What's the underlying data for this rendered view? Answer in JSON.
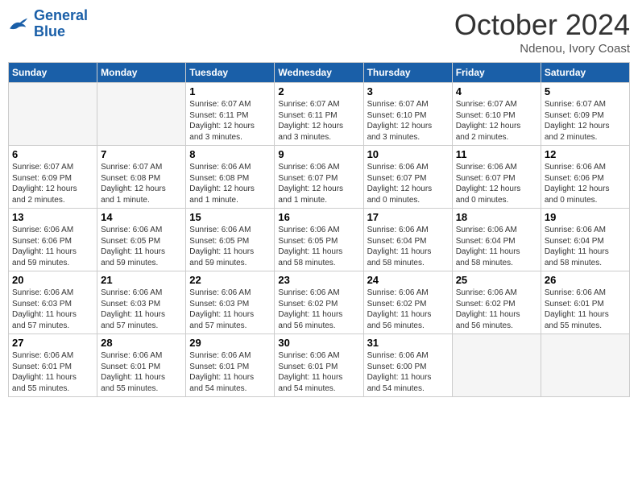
{
  "header": {
    "logo_line1": "General",
    "logo_line2": "Blue",
    "month": "October 2024",
    "location": "Ndenou, Ivory Coast"
  },
  "weekdays": [
    "Sunday",
    "Monday",
    "Tuesday",
    "Wednesday",
    "Thursday",
    "Friday",
    "Saturday"
  ],
  "weeks": [
    [
      {
        "day": "",
        "info": ""
      },
      {
        "day": "",
        "info": ""
      },
      {
        "day": "1",
        "info": "Sunrise: 6:07 AM\nSunset: 6:11 PM\nDaylight: 12 hours\nand 3 minutes."
      },
      {
        "day": "2",
        "info": "Sunrise: 6:07 AM\nSunset: 6:11 PM\nDaylight: 12 hours\nand 3 minutes."
      },
      {
        "day": "3",
        "info": "Sunrise: 6:07 AM\nSunset: 6:10 PM\nDaylight: 12 hours\nand 3 minutes."
      },
      {
        "day": "4",
        "info": "Sunrise: 6:07 AM\nSunset: 6:10 PM\nDaylight: 12 hours\nand 2 minutes."
      },
      {
        "day": "5",
        "info": "Sunrise: 6:07 AM\nSunset: 6:09 PM\nDaylight: 12 hours\nand 2 minutes."
      }
    ],
    [
      {
        "day": "6",
        "info": "Sunrise: 6:07 AM\nSunset: 6:09 PM\nDaylight: 12 hours\nand 2 minutes."
      },
      {
        "day": "7",
        "info": "Sunrise: 6:07 AM\nSunset: 6:08 PM\nDaylight: 12 hours\nand 1 minute."
      },
      {
        "day": "8",
        "info": "Sunrise: 6:06 AM\nSunset: 6:08 PM\nDaylight: 12 hours\nand 1 minute."
      },
      {
        "day": "9",
        "info": "Sunrise: 6:06 AM\nSunset: 6:07 PM\nDaylight: 12 hours\nand 1 minute."
      },
      {
        "day": "10",
        "info": "Sunrise: 6:06 AM\nSunset: 6:07 PM\nDaylight: 12 hours\nand 0 minutes."
      },
      {
        "day": "11",
        "info": "Sunrise: 6:06 AM\nSunset: 6:07 PM\nDaylight: 12 hours\nand 0 minutes."
      },
      {
        "day": "12",
        "info": "Sunrise: 6:06 AM\nSunset: 6:06 PM\nDaylight: 12 hours\nand 0 minutes."
      }
    ],
    [
      {
        "day": "13",
        "info": "Sunrise: 6:06 AM\nSunset: 6:06 PM\nDaylight: 11 hours\nand 59 minutes."
      },
      {
        "day": "14",
        "info": "Sunrise: 6:06 AM\nSunset: 6:05 PM\nDaylight: 11 hours\nand 59 minutes."
      },
      {
        "day": "15",
        "info": "Sunrise: 6:06 AM\nSunset: 6:05 PM\nDaylight: 11 hours\nand 59 minutes."
      },
      {
        "day": "16",
        "info": "Sunrise: 6:06 AM\nSunset: 6:05 PM\nDaylight: 11 hours\nand 58 minutes."
      },
      {
        "day": "17",
        "info": "Sunrise: 6:06 AM\nSunset: 6:04 PM\nDaylight: 11 hours\nand 58 minutes."
      },
      {
        "day": "18",
        "info": "Sunrise: 6:06 AM\nSunset: 6:04 PM\nDaylight: 11 hours\nand 58 minutes."
      },
      {
        "day": "19",
        "info": "Sunrise: 6:06 AM\nSunset: 6:04 PM\nDaylight: 11 hours\nand 58 minutes."
      }
    ],
    [
      {
        "day": "20",
        "info": "Sunrise: 6:06 AM\nSunset: 6:03 PM\nDaylight: 11 hours\nand 57 minutes."
      },
      {
        "day": "21",
        "info": "Sunrise: 6:06 AM\nSunset: 6:03 PM\nDaylight: 11 hours\nand 57 minutes."
      },
      {
        "day": "22",
        "info": "Sunrise: 6:06 AM\nSunset: 6:03 PM\nDaylight: 11 hours\nand 57 minutes."
      },
      {
        "day": "23",
        "info": "Sunrise: 6:06 AM\nSunset: 6:02 PM\nDaylight: 11 hours\nand 56 minutes."
      },
      {
        "day": "24",
        "info": "Sunrise: 6:06 AM\nSunset: 6:02 PM\nDaylight: 11 hours\nand 56 minutes."
      },
      {
        "day": "25",
        "info": "Sunrise: 6:06 AM\nSunset: 6:02 PM\nDaylight: 11 hours\nand 56 minutes."
      },
      {
        "day": "26",
        "info": "Sunrise: 6:06 AM\nSunset: 6:01 PM\nDaylight: 11 hours\nand 55 minutes."
      }
    ],
    [
      {
        "day": "27",
        "info": "Sunrise: 6:06 AM\nSunset: 6:01 PM\nDaylight: 11 hours\nand 55 minutes."
      },
      {
        "day": "28",
        "info": "Sunrise: 6:06 AM\nSunset: 6:01 PM\nDaylight: 11 hours\nand 55 minutes."
      },
      {
        "day": "29",
        "info": "Sunrise: 6:06 AM\nSunset: 6:01 PM\nDaylight: 11 hours\nand 54 minutes."
      },
      {
        "day": "30",
        "info": "Sunrise: 6:06 AM\nSunset: 6:01 PM\nDaylight: 11 hours\nand 54 minutes."
      },
      {
        "day": "31",
        "info": "Sunrise: 6:06 AM\nSunset: 6:00 PM\nDaylight: 11 hours\nand 54 minutes."
      },
      {
        "day": "",
        "info": ""
      },
      {
        "day": "",
        "info": ""
      }
    ]
  ]
}
